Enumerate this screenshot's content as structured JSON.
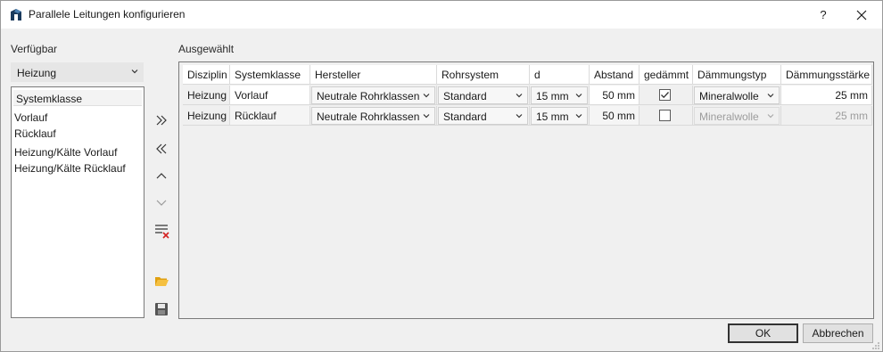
{
  "window": {
    "title": "Parallele Leitungen konfigurieren",
    "help_label": "?"
  },
  "left": {
    "label": "Verfügbar",
    "discipline_select": "Heizung",
    "list_header": "Systemklasse",
    "items": [
      "Vorlauf",
      "Rücklauf",
      "Heizung/Kälte Vorlauf",
      "Heizung/Kälte Rücklauf"
    ]
  },
  "right": {
    "label": "Ausgewählt",
    "columns": [
      "Disziplin",
      "Systemklasse",
      "Hersteller",
      "Rohrsystem",
      "d",
      "Abstand",
      "gedämmt",
      "Dämmungstyp",
      "Dämmungsstärke"
    ],
    "rows": [
      {
        "disziplin": "Heizung",
        "systemklasse": "Vorlauf",
        "hersteller": "Neutrale Rohrklassen",
        "rohrsystem": "Standard",
        "d": "15 mm",
        "abstand": "50 mm",
        "gedaemmt": true,
        "daemmungstyp": "Mineralwolle",
        "daemmungsstaerke": "25 mm"
      },
      {
        "disziplin": "Heizung",
        "systemklasse": "Rücklauf",
        "hersteller": "Neutrale Rohrklassen",
        "rohrsystem": "Standard",
        "d": "15 mm",
        "abstand": "50 mm",
        "gedaemmt": false,
        "daemmungstyp": "Mineralwolle",
        "daemmungsstaerke": "25 mm"
      }
    ]
  },
  "toolbar_icons": [
    "move-all-right-icon",
    "move-all-left-icon",
    "move-up-icon",
    "move-down-icon",
    "clear-list-icon",
    "open-folder-icon",
    "save-icon"
  ],
  "buttons": {
    "ok": "OK",
    "cancel": "Abbrechen"
  },
  "colors": {
    "accent": "#1a3a5c",
    "disabled_text": "#9c9c9c",
    "delete_red": "#d42020",
    "folder": "#f0b020"
  }
}
